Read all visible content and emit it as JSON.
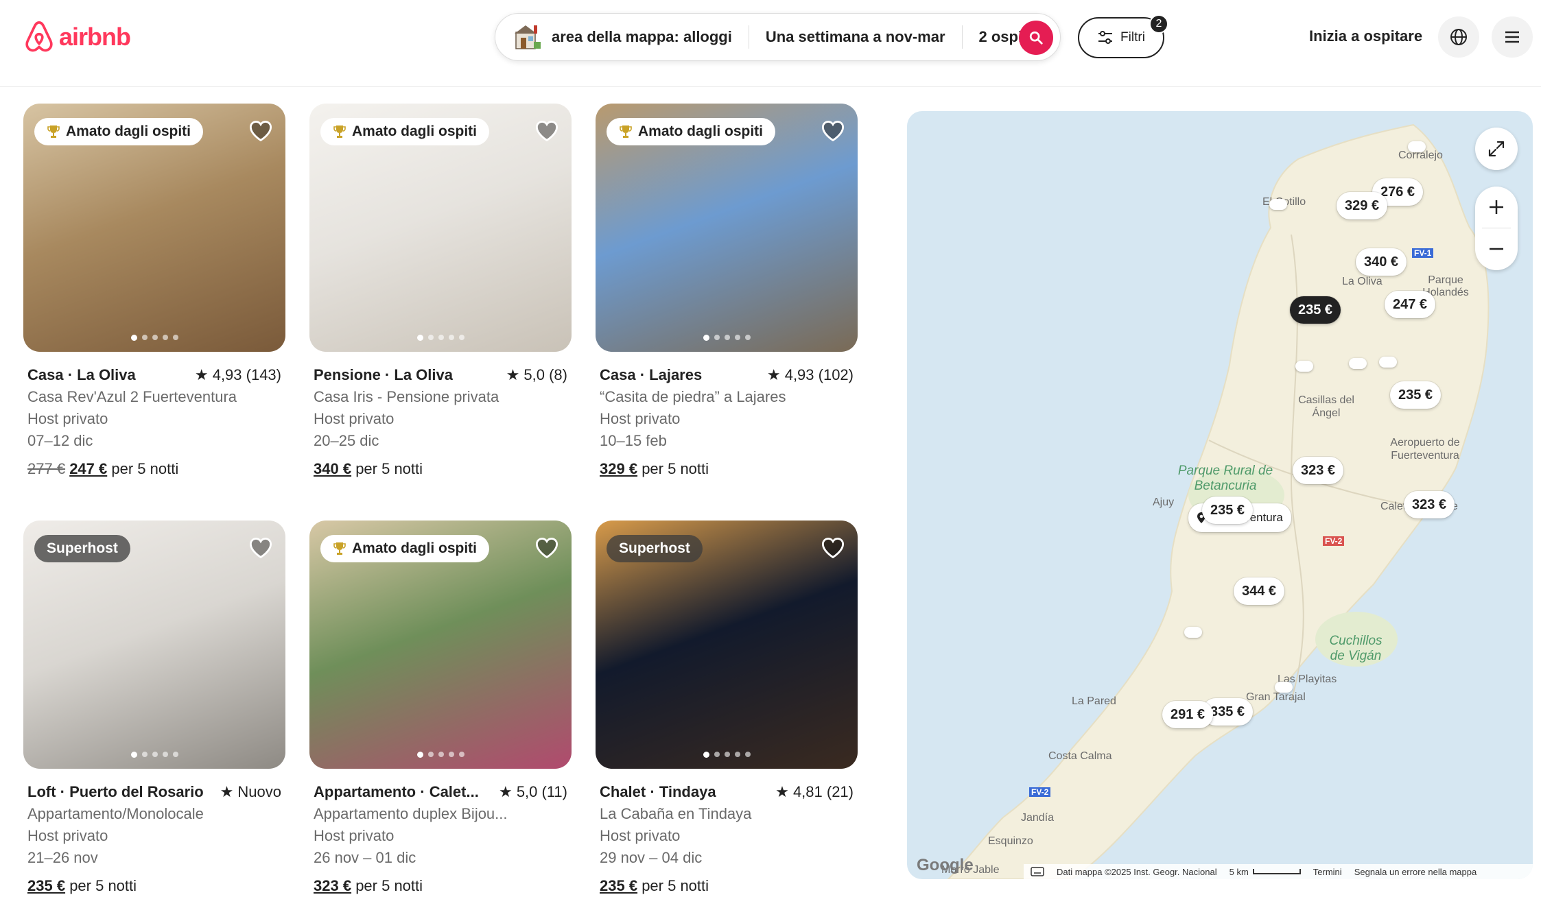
{
  "header": {
    "logo_text": "airbnb",
    "search": {
      "location": "area della mappa: alloggi",
      "dates": "Una settimana a nov-mar",
      "guests": "2 ospiti"
    },
    "filters": {
      "label": "Filtri",
      "count": "2"
    },
    "host_link": "Inizia a ospitare",
    "brand_color": "#ff385c"
  },
  "listings": [
    {
      "badge": "Amato dagli ospiti",
      "badge_style": "guest-favorite",
      "type": "Casa",
      "location": "La Oliva",
      "rating": "4,93 (143)",
      "name": "Casa Rev'Azul 2 Fuerteventura",
      "host": "Host privato",
      "dates": "07–12 dic",
      "old_price": "277 €",
      "price": "247 €",
      "price_suffix": "per 5 notti"
    },
    {
      "badge": "Amato dagli ospiti",
      "badge_style": "guest-favorite",
      "type": "Pensione",
      "location": "La Oliva",
      "rating": "5,0 (8)",
      "name": "Casa Iris - Pensione privata",
      "host": "Host privato",
      "dates": "20–25 dic",
      "old_price": "",
      "price": "340 €",
      "price_suffix": "per 5 notti"
    },
    {
      "badge": "Amato dagli ospiti",
      "badge_style": "guest-favorite",
      "type": "Casa",
      "location": "Lajares",
      "rating": "4,93 (102)",
      "name": "“Casita de piedra” a Lajares",
      "host": "Host privato",
      "dates": "10–15 feb",
      "old_price": "",
      "price": "329 €",
      "price_suffix": "per 5 notti"
    },
    {
      "badge": "Superhost",
      "badge_style": "superhost",
      "type": "Loft",
      "location": "Puerto del Rosario",
      "rating": "Nuovo",
      "name": "Appartamento/Monolocale",
      "host": "Host privato",
      "dates": "21–26 nov",
      "old_price": "",
      "price": "235 €",
      "price_suffix": "per 5 notti"
    },
    {
      "badge": "Amato dagli ospiti",
      "badge_style": "guest-favorite",
      "type": "Appartamento",
      "location": "Calet...",
      "rating": "5,0 (11)",
      "name": "Appartamento duplex Bijou...",
      "host": "Host privato",
      "dates": "26 nov – 01 dic",
      "old_price": "",
      "price": "323 €",
      "price_suffix": "per 5 notti"
    },
    {
      "badge": "Superhost",
      "badge_style": "superhost",
      "type": "Chalet",
      "location": "Tindaya",
      "rating": "4,81 (21)",
      "name": "La Cabaña en Tindaya",
      "host": "Host privato",
      "dates": "29 nov – 04 dic",
      "old_price": "",
      "price": "235 €",
      "price_suffix": "per 5 notti"
    }
  ],
  "map": {
    "price_pins": [
      "276 €",
      "329 €",
      "340 €",
      "235 €",
      "247 €",
      "235 €",
      "323 €",
      "235 €",
      "323 €",
      "344 €",
      "335 €",
      "291 €"
    ],
    "selected_pin": "235 €",
    "place_labels": [
      "Corralejo",
      "El Cotillo",
      "La Oliva",
      "Parque Holandés",
      "Casillas del Ángel",
      "Aeropuerto de Fuerteventura",
      "Ajuy",
      "Caleta de Fuste",
      "Las Playitas",
      "Gran Tarajal",
      "La Pared",
      "Costa Calma",
      "Jandía",
      "Esquinzo",
      "Morro Jable"
    ],
    "park_labels": [
      "Parque Rural de Betancuria",
      "Cuchillos de Vigán"
    ],
    "selected_place": "Fuerteventura",
    "road_signs": [
      "FV-1",
      "FV-2",
      "FV-2"
    ],
    "footer": {
      "data": "Dati mappa ©2025 Inst. Geogr. Nacional",
      "scale": "5 km",
      "terms": "Termini",
      "report": "Segnala un errore nella mappa"
    },
    "google": "Google",
    "colors": {
      "sea": "#d6e7f2",
      "land": "#f3efdd",
      "park": "#e3ecd0"
    }
  }
}
